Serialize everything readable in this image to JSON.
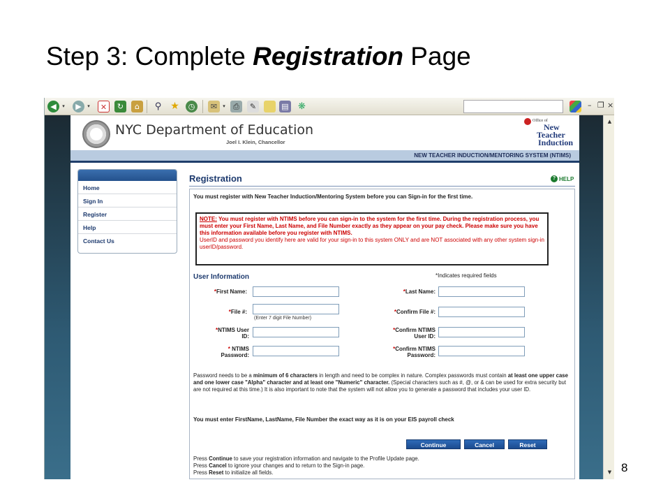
{
  "slide": {
    "title_prefix": "Step 3: Complete ",
    "title_bold": "Registration",
    "title_suffix": " Page",
    "page_number": "8"
  },
  "browser": {
    "window_controls": {
      "minimize": "–",
      "restore": "❐",
      "close": "×"
    }
  },
  "header": {
    "org_name": "NYC Department of Education",
    "chancellor": "Joel I. Klein, Chancellor",
    "logo_office": "Office of",
    "logo_line1": "New",
    "logo_line2": "Teacher",
    "logo_line3": "Induction",
    "system_name": "NEW TEACHER INDUCTION/MENTORING SYSTEM (NTIMS)"
  },
  "sidebar": {
    "items": [
      {
        "label": "Home"
      },
      {
        "label": "Sign In"
      },
      {
        "label": "Register"
      },
      {
        "label": "Help"
      },
      {
        "label": "Contact Us"
      }
    ]
  },
  "main": {
    "title": "Registration",
    "help_label": "HELP",
    "help_icon_glyph": "?",
    "intro": "You must register with New Teacher Induction/Mentoring System before you can Sign-in for the first time.",
    "note_label": "NOTE:",
    "note_bold": " You must register with NTIMS before you can sign-in to the system for the first time. During the registration process, you must enter your First Name, Last Name, and File Number exactly as they appear on your pay check. Please make sure you have this information available before you register with NTIMS.",
    "note_plain": "UserID and password you identify here are valid for your sign-in to this system ONLY and are NOT associated with any other system sign-in userID/password.",
    "user_info_title": "User Information",
    "required_note": "*Indicates required fields"
  },
  "form": {
    "first_name": {
      "label": "First Name:",
      "value": ""
    },
    "last_name": {
      "label": "Last Name:",
      "value": ""
    },
    "file_no": {
      "label": "File #:",
      "value": "",
      "hint": "(Enter 7 digit File Number)"
    },
    "confirm_file": {
      "label": "Confirm File #:",
      "value": ""
    },
    "ntims_user_id": {
      "label_l1": "NTIMS User",
      "label_l2": "ID:",
      "value": ""
    },
    "confirm_user_id": {
      "label_l1": "Confirm NTIMS",
      "label_l2": "User ID:",
      "value": ""
    },
    "ntims_password": {
      "label_l1": "NTIMS",
      "label_l2": "Password:",
      "value": ""
    },
    "confirm_password": {
      "label_l1": "Confirm NTIMS",
      "label_l2": "Password:",
      "value": ""
    },
    "asterisk": "*"
  },
  "password_rules": {
    "p1": "Password needs to be a ",
    "b1": "minimum of 6 characters",
    "p2": " in length and need to be complex in nature. Complex passwords must contain ",
    "b2": "at least one upper case and one lower case \"Alpha\" character and at least one \"Numeric\" character.",
    "p3": " (Special characters such as #, @, or & can be used for extra security but are not required at this time.) It is also important to note that the system will not allow you to generate a password that includes your user ID."
  },
  "eis_note": "You must enter FirstName, LastName, File Number the exact way as it is on your EIS payroll check",
  "buttons": {
    "continue": "Continue",
    "cancel": "Cancel",
    "reset": "Reset"
  },
  "instructions": {
    "press": "Press ",
    "continue_word": "Continue",
    "continue_rest": " to save your registration information and navigate to the Profile Update page.",
    "cancel_word": "Cancel",
    "cancel_rest": " to ignore your changes and to return to the Sign-in page.",
    "reset_word": "Reset",
    "reset_rest": " to initialize all fields."
  },
  "colors": {
    "accent": "#1d3a6e",
    "note_red": "#cc0000",
    "help_green": "#1b7a2e",
    "button_blue": "#2f6bb8"
  }
}
